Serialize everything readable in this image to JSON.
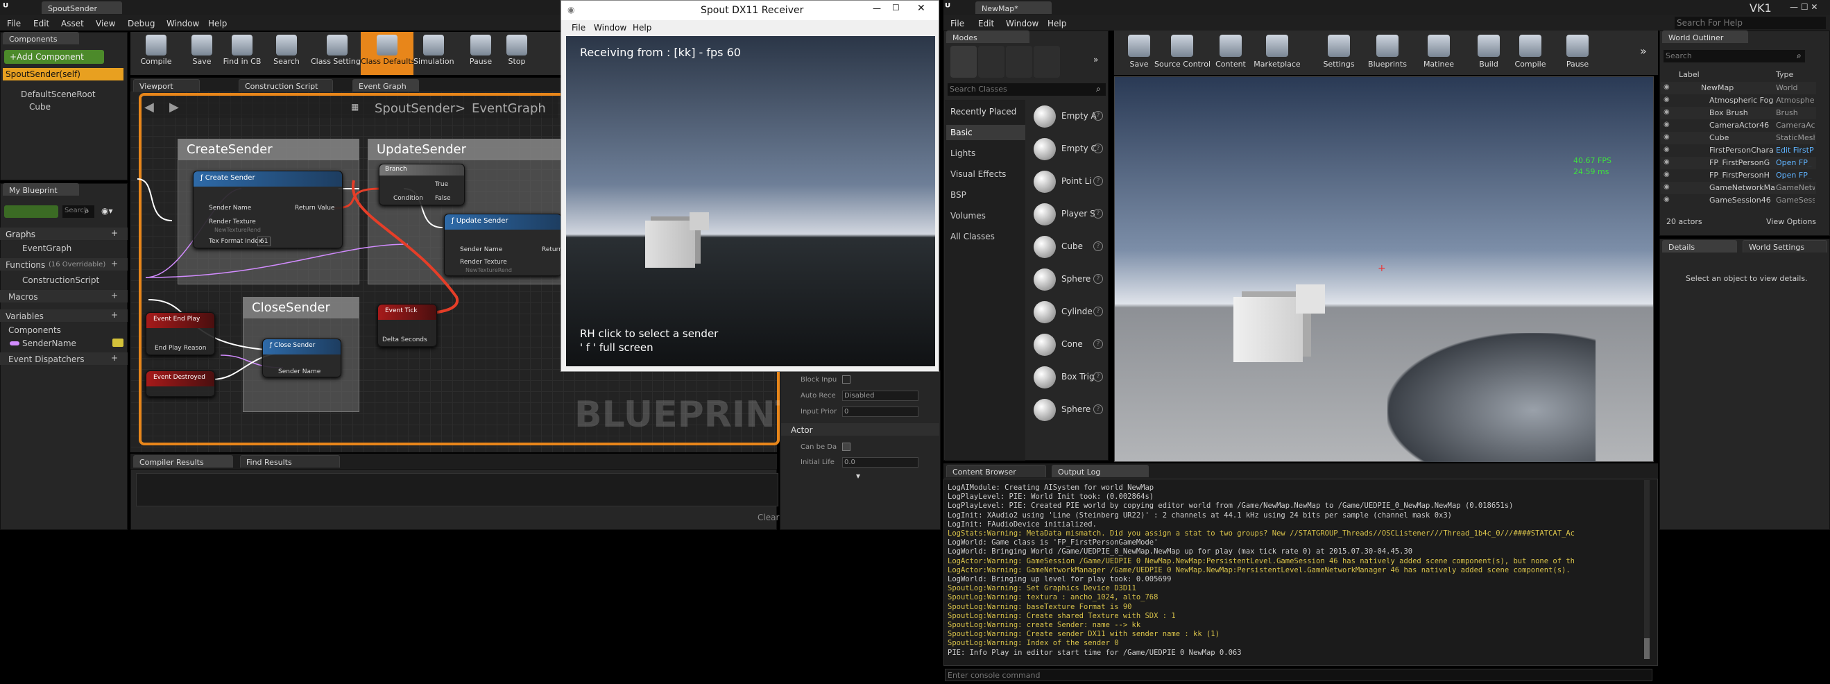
{
  "left_editor": {
    "tab_title": "SpoutSender",
    "menu": [
      "File",
      "Edit",
      "Asset",
      "View",
      "Debug",
      "Window",
      "Help"
    ],
    "components_tab": "Components",
    "add_component": "+Add Component",
    "component_self": "SpoutSender(self)",
    "component_tree": [
      "DefaultSceneRoot",
      "Cube"
    ],
    "toolbar": [
      "Compile",
      "Save",
      "Find in CB",
      "Search",
      "Class Settings",
      "Class Defaults",
      "Simulation",
      "Pause",
      "Stop"
    ],
    "graph_tabs": [
      "Viewport",
      "Construction Script",
      "Event Graph"
    ],
    "breadcrumb_root": "SpoutSender",
    "breadcrumb_leaf": "EventGraph",
    "my_blueprint_tab": "My Blueprint",
    "search_placeholder": "Search",
    "sections": {
      "graphs": "Graphs",
      "event_graph": "EventGraph",
      "functions": "Functions",
      "functions_note": "(16 Overridable)",
      "construction_script": "ConstructionScript",
      "macros": "Macros",
      "variables": "Variables",
      "components": "Components",
      "sender_name": "SenderName",
      "event_dispatchers": "Event Dispatchers"
    },
    "comments": [
      "CreateSender",
      "UpdateSender",
      "CloseSender"
    ],
    "nodes": {
      "create_sender": {
        "title": "Create Sender",
        "pins": [
          "Sender Name",
          "Return Value",
          "Render Texture",
          "NewTextureRend",
          "Tex Format Index",
          "61"
        ]
      },
      "branch": {
        "title": "Branch",
        "pins": [
          "True",
          "Condition",
          "False"
        ]
      },
      "update_sender": {
        "title": "Update Sender",
        "pins": [
          "Sender Name",
          "Return",
          "Render Texture",
          "NewTextureRend"
        ]
      },
      "event_tick": {
        "title": "Event Tick",
        "pins": [
          "Delta Seconds"
        ]
      },
      "event_end_play": {
        "title": "Event End Play",
        "pins": [
          "End Play Reason"
        ]
      },
      "close_sender": {
        "title": "Close Sender",
        "pins": [
          "Sender Name"
        ]
      },
      "event_destroyed": {
        "title": "Event Destroyed"
      }
    },
    "watermark": "BLUEPRINT",
    "bottom_tabs": [
      "Compiler Results",
      "Find Results"
    ],
    "clear": "Clear",
    "details": {
      "block_input": "Block Inpu",
      "auto_receive": "Auto Rece",
      "auto_receive_value": "Disabled",
      "input_priority": "Input Prior",
      "input_priority_value": "0",
      "actor_section": "Actor",
      "can_be_damaged": "Can be Da",
      "initial_life": "Initial Lifе",
      "initial_life_value": "0.0"
    }
  },
  "receiver": {
    "title": "Spout DX11 Receiver",
    "menu": [
      "File",
      "Window",
      "Help"
    ],
    "status": "Receiving from : [kk] - fps 60",
    "hint1": "RH click to select  a sender",
    "hint2": "' f ' full screen"
  },
  "right_editor": {
    "tab_title": "NewMap*",
    "user": "VK1",
    "search_help": "Search For Help",
    "menu": [
      "File",
      "Edit",
      "Window",
      "Help"
    ],
    "modes_tab": "Modes",
    "search_classes": "Search Classes",
    "categories": [
      "Recently Placed",
      "Basic",
      "Lights",
      "Visual Effects",
      "BSP",
      "Volumes",
      "All Classes"
    ],
    "place_items": [
      "Empty A",
      "Empty C",
      "Point Li",
      "Player S",
      "Cube",
      "Sphere",
      "Cylinde",
      "Cone",
      "Box Trig",
      "Sphere"
    ],
    "toolbar": [
      "Save",
      "Source Control",
      "Content",
      "Marketplace",
      "Settings",
      "Blueprints",
      "Matinee",
      "Build",
      "Compile",
      "Pause"
    ],
    "viewport_stats": {
      "fps": "40.67 FPS",
      "ms": "24.59 ms"
    },
    "outliner_tab": "World Outliner",
    "outliner_search": "Search",
    "outliner_cols": [
      "Label",
      "Type"
    ],
    "outliner_rows": [
      [
        "NewMap",
        "World"
      ],
      [
        "Atmospheric Fog",
        "Atmospher"
      ],
      [
        "Box Brush",
        "Brush"
      ],
      [
        "CameraActor46",
        "CameraAc"
      ],
      [
        "Cube",
        "StaticMesh"
      ],
      [
        "FirstPersonChara",
        "Edit FirstP"
      ],
      [
        "FP_FirstPersonG",
        "Open FP_"
      ],
      [
        "FP_FirstPersonH",
        "Open FP_"
      ],
      [
        "GameNetworkMa",
        "GameNetw"
      ],
      [
        "GameSession46",
        "GameSessi"
      ]
    ],
    "actor_count": "20 actors",
    "view_options": "View Options",
    "details_tab": "Details",
    "world_settings_tab": "World Settings",
    "details_empty": "Select an object to view details.",
    "content_browser_tab": "Content Browser",
    "output_log_tab": "Output Log",
    "console_placeholder": "Enter console command",
    "log": [
      {
        "c": "#cfcfcf",
        "t": "LogAIModule: Creating AISystem for world NewMap"
      },
      {
        "c": "#cfcfcf",
        "t": "LogPlayLevel: PIE: World Init took: (0.002864s)"
      },
      {
        "c": "#cfcfcf",
        "t": "LogPlayLevel: PIE: Created PIE world by copying editor world from /Game/NewMap.NewMap to /Game/UEDPIE_0_NewMap.NewMap (0.018651s)"
      },
      {
        "c": "#cfcfcf",
        "t": "LogInit: XAudio2 using 'Line (Steinberg UR22)' : 2 channels at 44.1 kHz using 24 bits per sample (channel mask 0x3)"
      },
      {
        "c": "#cfcfcf",
        "t": "LogInit: FAudioDevice initialized."
      },
      {
        "c": "#d8c24a",
        "t": "LogStats:Warning: MetaData mismatch. Did you assign a stat to two groups? New //STATGROUP_Threads//OSCListener///Thread_1b4c_0///####STATCAT_Ac"
      },
      {
        "c": "#cfcfcf",
        "t": "LogWorld: Game class is 'FP_FirstPersonGameMode'"
      },
      {
        "c": "#cfcfcf",
        "t": "LogWorld: Bringing World /Game/UEDPIE_0_NewMap.NewMap up for play (max tick rate 0) at 2015.07.30-04.45.30"
      },
      {
        "c": "#d8c24a",
        "t": "LogActor:Warning: GameSession /Game/UEDPIE_0_NewMap.NewMap:PersistentLevel.GameSession_46 has natively added scene component(s), but none of th"
      },
      {
        "c": "#d8c24a",
        "t": "LogActor:Warning: GameNetworkManager /Game/UEDPIE_0_NewMap.NewMap:PersistentLevel.GameNetworkManager_46 has natively added scene component(s)."
      },
      {
        "c": "#cfcfcf",
        "t": "LogWorld: Bringing up level for play took: 0.005699"
      },
      {
        "c": "#d8c24a",
        "t": "SpoutLog:Warning: Set Graphics Device D3D11"
      },
      {
        "c": "#d8c24a",
        "t": "SpoutLog:Warning: textura : ancho_1024, alto_768"
      },
      {
        "c": "#d8c24a",
        "t": "SpoutLog:Warning: baseTexture Format is 90"
      },
      {
        "c": "#d8c24a",
        "t": "SpoutLog:Warning: Create shared Texture with SDX : 1"
      },
      {
        "c": "#d8c24a",
        "t": "SpoutLog:Warning: create Sender: name --> kk"
      },
      {
        "c": "#d8c24a",
        "t": "SpoutLog:Warning: Create sender DX11 with sender name : kk (1)"
      },
      {
        "c": "#d8c24a",
        "t": "SpoutLog:Warning: Index of the sender 0"
      },
      {
        "c": "#cfcfcf",
        "t": "PIE: Info Play in editor start time for /Game/UEDPIE_0_NewMap 0.063"
      }
    ]
  }
}
